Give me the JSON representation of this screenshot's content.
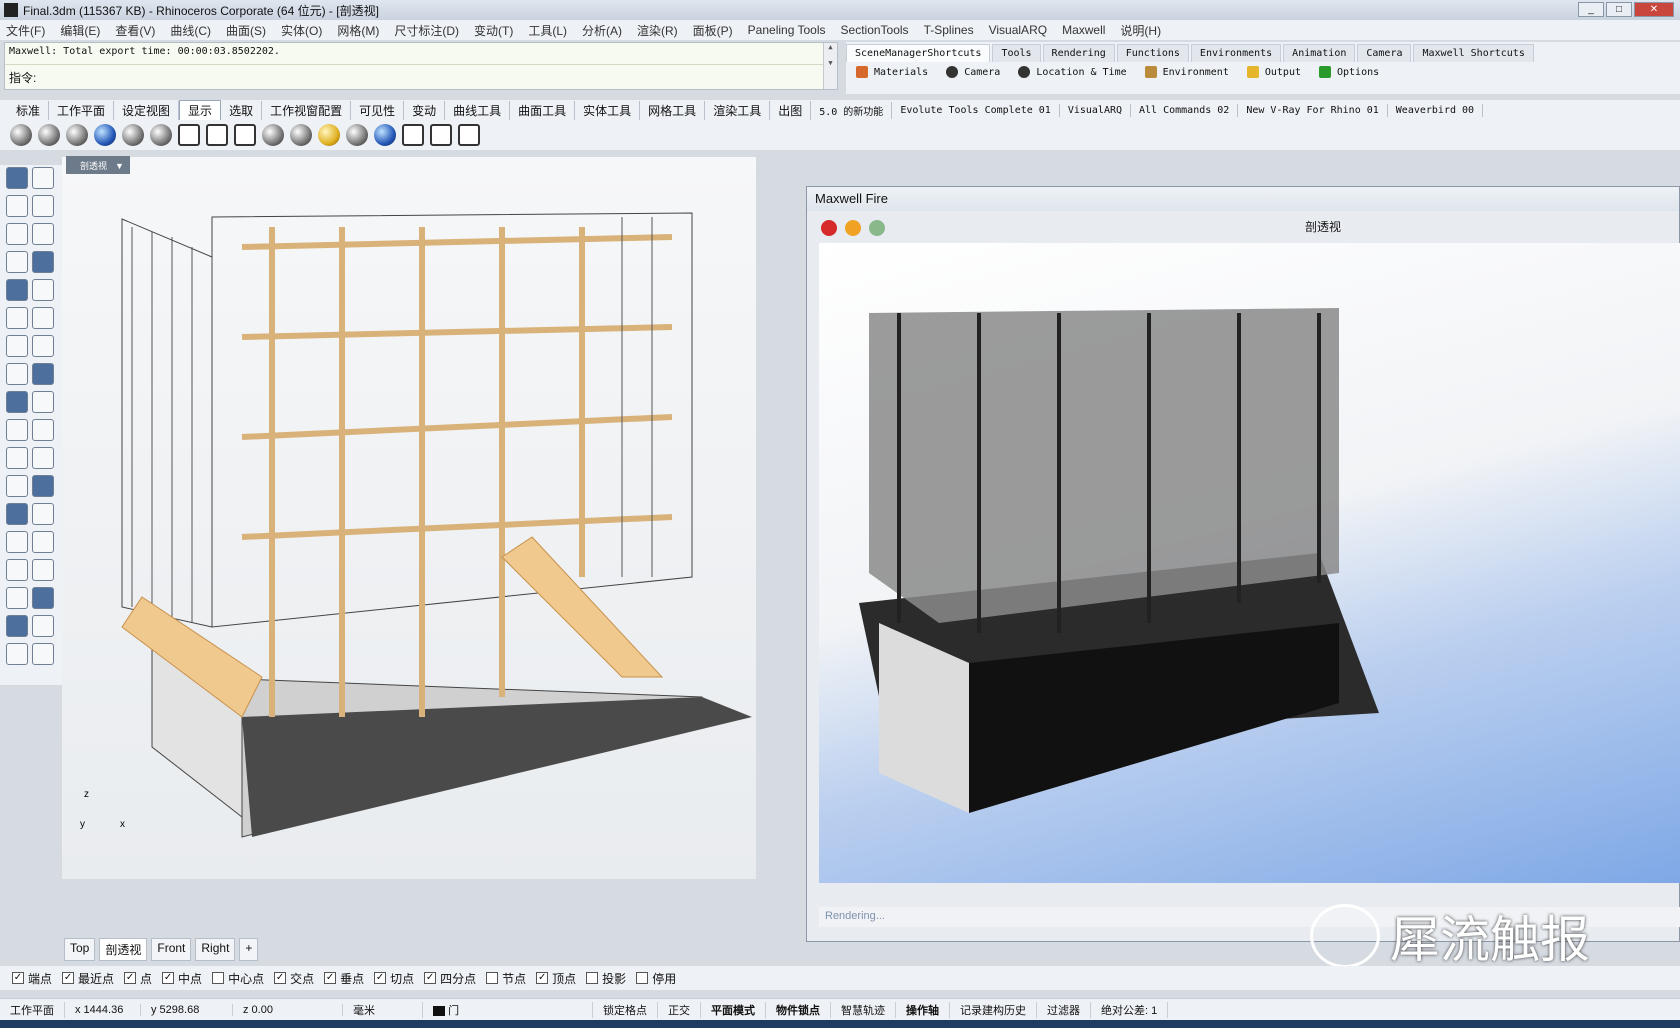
{
  "window": {
    "title": "Final.3dm (115367 KB) - Rhinoceros Corporate (64 位元) - [剖透视]"
  },
  "menu": [
    "文件(F)",
    "编辑(E)",
    "查看(V)",
    "曲线(C)",
    "曲面(S)",
    "实体(O)",
    "网格(M)",
    "尺寸标注(D)",
    "变动(T)",
    "工具(L)",
    "分析(A)",
    "渲染(R)",
    "面板(P)",
    "Paneling Tools",
    "SectionTools",
    "T-Splines",
    "VisualARQ",
    "Maxwell",
    "说明(H)"
  ],
  "command": {
    "history": "Maxwell: Total export time: 00:00:03.8502202.",
    "prompt": "指令:"
  },
  "right_panel": {
    "tabs": [
      "SceneManagerShortcuts",
      "Tools",
      "Rendering",
      "Functions",
      "Environments",
      "Animation",
      "Camera",
      "Maxwell Shortcuts"
    ],
    "tools": [
      "Materials",
      "Camera",
      "Location & Time",
      "Environment",
      "Output",
      "Options"
    ]
  },
  "toolbar_tabs": [
    "标准",
    "工作平面",
    "设定视图",
    "显示",
    "选取",
    "工作视窗配置",
    "可见性",
    "变动",
    "曲线工具",
    "曲面工具",
    "实体工具",
    "网格工具",
    "渲染工具",
    "出图",
    "5.0 的新功能",
    "Evolute Tools Complete 01",
    "VisualARQ",
    "All Commands 02",
    "New V-Ray For Rhino 01",
    "Weaverbird 00"
  ],
  "viewport": {
    "name": "剖透视",
    "axis": {
      "z": "z",
      "y": "y",
      "x": "x"
    }
  },
  "maxwell": {
    "title": "Maxwell Fire",
    "view_name": "剖透视",
    "status": "Rendering..."
  },
  "viewport_tabs": [
    "Top",
    "剖透视",
    "Front",
    "Right",
    "+"
  ],
  "osnaps": [
    {
      "label": "端点",
      "checked": true
    },
    {
      "label": "最近点",
      "checked": true
    },
    {
      "label": "点",
      "checked": true
    },
    {
      "label": "中点",
      "checked": true
    },
    {
      "label": "中心点",
      "checked": false
    },
    {
      "label": "交点",
      "checked": true
    },
    {
      "label": "垂点",
      "checked": true
    },
    {
      "label": "切点",
      "checked": true
    },
    {
      "label": "四分点",
      "checked": true
    },
    {
      "label": "节点",
      "checked": false
    },
    {
      "label": "顶点",
      "checked": true
    },
    {
      "label": "投影",
      "checked": false
    },
    {
      "label": "停用",
      "checked": false
    }
  ],
  "status": {
    "plane": "工作平面",
    "x": "x 1444.36",
    "y": "y 5298.68",
    "z": "z 0.00",
    "units": "毫米",
    "layer": "门",
    "toggles": [
      "锁定格点",
      "正交",
      "平面模式",
      "物件锁点",
      "智慧轨迹",
      "操作轴",
      "记录建构历史",
      "过滤器"
    ],
    "bold": [
      false,
      false,
      true,
      true,
      false,
      true,
      false,
      false
    ],
    "tolerance": "绝对公差: 1"
  },
  "watermark": "犀流触报",
  "colors": {
    "timber": "#e6c48c",
    "frame": "#3a3a3a",
    "sky": "#7fa8e6"
  }
}
